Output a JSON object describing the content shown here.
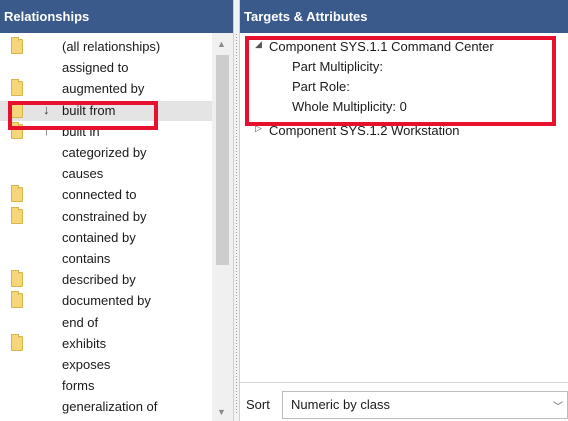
{
  "relationships": {
    "header": "Relationships",
    "items": [
      {
        "label": "(all relationships)",
        "folder": true,
        "arrow": ""
      },
      {
        "label": "assigned to",
        "folder": false,
        "arrow": ""
      },
      {
        "label": "augmented by",
        "folder": true,
        "arrow": ""
      },
      {
        "label": "built from",
        "folder": true,
        "arrow": "↓",
        "selected": true
      },
      {
        "label": "built in",
        "folder": true,
        "arrow": "↑"
      },
      {
        "label": "categorized by",
        "folder": false,
        "arrow": ""
      },
      {
        "label": "causes",
        "folder": false,
        "arrow": ""
      },
      {
        "label": "connected to",
        "folder": true,
        "arrow": ""
      },
      {
        "label": "constrained by",
        "folder": true,
        "arrow": ""
      },
      {
        "label": "contained by",
        "folder": false,
        "arrow": ""
      },
      {
        "label": "contains",
        "folder": false,
        "arrow": ""
      },
      {
        "label": "described by",
        "folder": true,
        "arrow": ""
      },
      {
        "label": "documented by",
        "folder": true,
        "arrow": ""
      },
      {
        "label": "end of",
        "folder": false,
        "arrow": ""
      },
      {
        "label": "exhibits",
        "folder": true,
        "arrow": ""
      },
      {
        "label": "exposes",
        "folder": false,
        "arrow": ""
      },
      {
        "label": "forms",
        "folder": false,
        "arrow": ""
      },
      {
        "label": "generalization of",
        "folder": false,
        "arrow": ""
      }
    ],
    "scroll_up_icon": "chevron-up-icon",
    "scroll_down_icon": "chevron-down-icon"
  },
  "targets": {
    "header": "Targets & Attributes",
    "nodes": [
      {
        "label": "Component SYS.1.1 Command Center",
        "expanded": true,
        "toggle": "◢",
        "attributes": [
          "Part Multiplicity:",
          "Part Role:",
          "Whole Multiplicity: 0"
        ]
      },
      {
        "label": "Component SYS.1.2 Workstation",
        "expanded": false,
        "toggle": "▷",
        "attributes": []
      }
    ]
  },
  "sort": {
    "label": "Sort",
    "value": "Numeric by class"
  },
  "colors": {
    "header_bg": "#3a5a8c",
    "highlight": "#e8112d",
    "folder": "#f6d67a"
  }
}
